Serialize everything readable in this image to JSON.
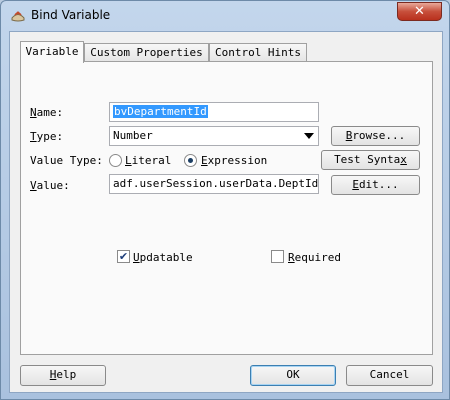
{
  "window": {
    "title": "Bind Variable",
    "close_glyph": "✕"
  },
  "tabs": [
    {
      "label": "Variable",
      "active": true
    },
    {
      "label": "Custom Properties",
      "active": false
    },
    {
      "label": "Control Hints",
      "active": false
    }
  ],
  "form": {
    "name": {
      "label_u": "N",
      "label_rest": "ame:",
      "value": "bvDepartmentId"
    },
    "type": {
      "label_u": "T",
      "label_rest": "ype:",
      "value": "Number"
    },
    "value_type": {
      "label": "Value Type:",
      "options": [
        {
          "label_u": "L",
          "label_rest": "iteral",
          "checked": false
        },
        {
          "label_u": "E",
          "label_rest": "xpression",
          "checked": true
        }
      ]
    },
    "value": {
      "label_u": "V",
      "label_rest": "alue:",
      "value": "adf.userSession.userData.DeptId"
    }
  },
  "buttons": {
    "browse": {
      "u": "B",
      "rest": "rowse..."
    },
    "test_syntax": {
      "pre": "Test Synta",
      "u": "x"
    },
    "edit": {
      "u": "E",
      "rest": "dit..."
    }
  },
  "options": {
    "updatable": {
      "label_u": "U",
      "label_rest": "pdatable",
      "checked": true
    },
    "required": {
      "label_u": "R",
      "label_rest": "equired",
      "checked": false
    }
  },
  "footer": {
    "help": {
      "u": "H",
      "rest": "elp"
    },
    "ok": "OK",
    "cancel": "Cancel"
  },
  "colors": {
    "selection": "#3399ff",
    "accent_border": "#3c7fb1"
  }
}
